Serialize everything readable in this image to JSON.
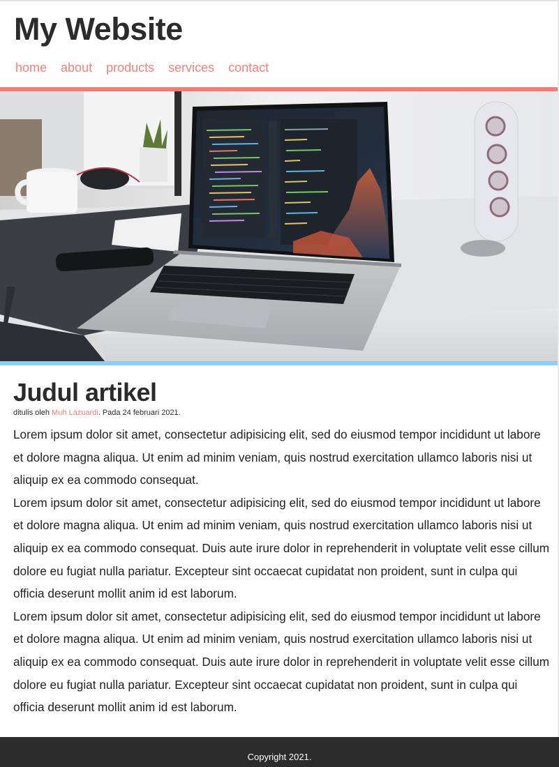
{
  "header": {
    "title": "My Website",
    "nav": [
      "home",
      "about",
      "products",
      "services",
      "contact"
    ]
  },
  "hero": {
    "top_border_color": "#f47c74",
    "bottom_border_color": "#8fcdf5"
  },
  "article": {
    "title": "Judul artikel",
    "meta_prefix": "ditulis oleh ",
    "author": "Muh Lazuardi",
    "meta_suffix": ". Pada 24 februari 2021.",
    "paragraphs": [
      "Lorem ipsum dolor sit amet, consectetur adipisicing elit, sed do eiusmod tempor incididunt ut labore et dolore magna aliqua. Ut enim ad minim veniam, quis nostrud exercitation ullamco laboris nisi ut aliquip ex ea commodo consequat.",
      "Lorem ipsum dolor sit amet, consectetur adipisicing elit, sed do eiusmod tempor incididunt ut labore et dolore magna aliqua. Ut enim ad minim veniam, quis nostrud exercitation ullamco laboris nisi ut aliquip ex ea commodo consequat. Duis aute irure dolor in reprehenderit in voluptate velit esse cillum dolore eu fugiat nulla pariatur. Excepteur sint occaecat cupidatat non proident, sunt in culpa qui officia deserunt mollit anim id est laborum.",
      "Lorem ipsum dolor sit amet, consectetur adipisicing elit, sed do eiusmod tempor incididunt ut labore et dolore magna aliqua. Ut enim ad minim veniam, quis nostrud exercitation ullamco laboris nisi ut aliquip ex ea commodo consequat. Duis aute irure dolor in reprehenderit in voluptate velit esse cillum dolore eu fugiat nulla pariatur. Excepteur sint occaecat cupidatat non proident, sunt in culpa qui officia deserunt mollit anim id est laborum."
    ]
  },
  "footer": {
    "copyright": "Copyright 2021.",
    "background": "#2c2c2c"
  },
  "colors": {
    "accent": "#f5807b",
    "text": "#2b2b2b"
  }
}
